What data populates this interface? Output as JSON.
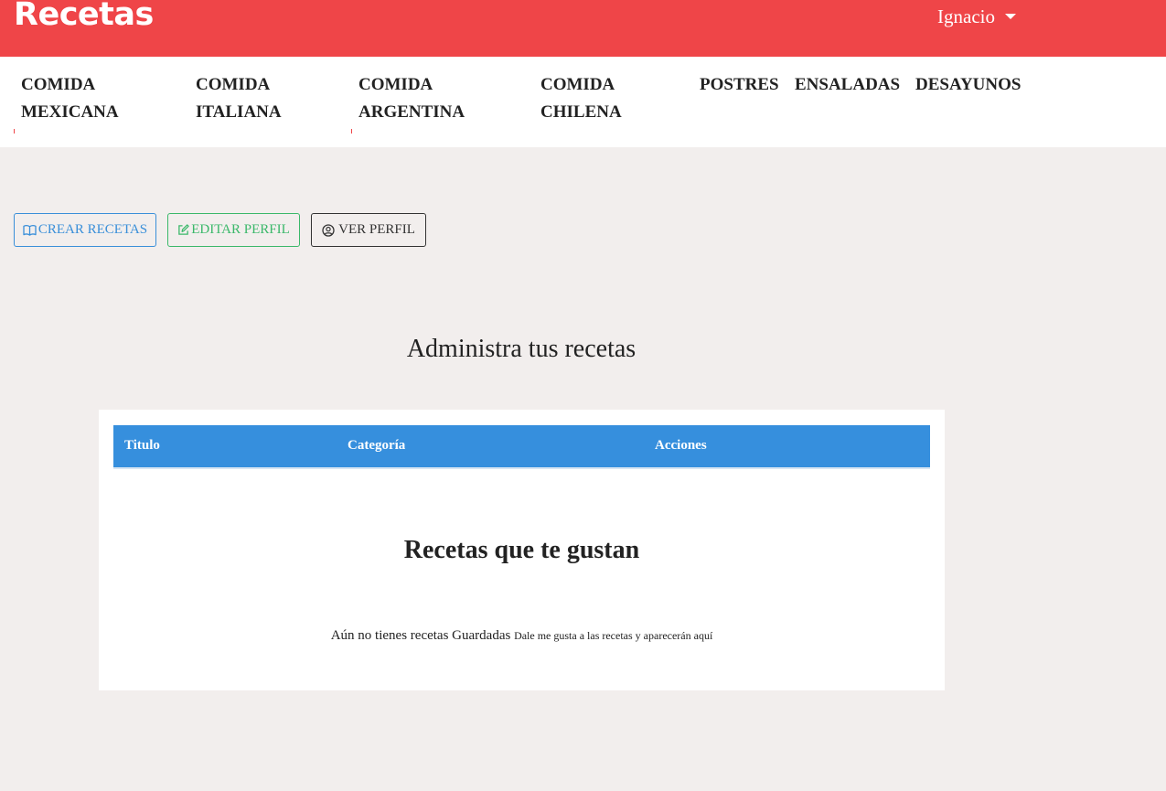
{
  "header": {
    "brand": "Recetas",
    "user_name": "Ignacio"
  },
  "categories": [
    {
      "line1": "COMIDA",
      "line2": "MEXICANA"
    },
    {
      "line1": "COMIDA",
      "line2": "ITALIANA"
    },
    {
      "line1": "COMIDA",
      "line2": "ARGENTINA"
    },
    {
      "line1": "COMIDA",
      "line2": "CHILENA"
    },
    {
      "line1": "POSTRES",
      "line2": ""
    },
    {
      "line1": "ENSALADAS",
      "line2": ""
    },
    {
      "line1": "DESAYUNOS",
      "line2": ""
    }
  ],
  "actions": {
    "create_label": "CREAR RECETAS",
    "edit_label": "EDITAR PERFIL",
    "view_label": "VER PERFIL"
  },
  "admin": {
    "title": "Administra tus recetas",
    "columns": [
      "Titulo",
      "Categoría",
      "Acciones"
    ]
  },
  "likes": {
    "title": "Recetas que te gustan",
    "empty_main": "Aún no tienes recetas Guardadas",
    "empty_hint": "Dale me gusta a las recetas y aparecerán aquí"
  },
  "colors": {
    "topbar": "#ef4548",
    "table_header": "#368fdd",
    "create_button": "#3a8fd9",
    "edit_button": "#3bb86a",
    "page_background": "#f2eeed"
  },
  "icons": {
    "create": "open-book-icon",
    "edit": "edit-square-icon",
    "view": "user-circle-icon",
    "user_menu": "caret-down-icon"
  }
}
